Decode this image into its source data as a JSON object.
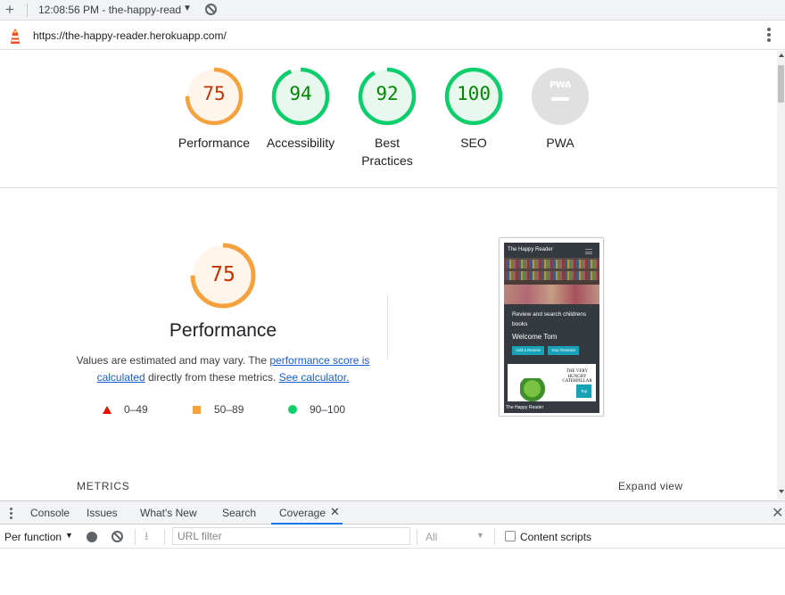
{
  "topbar": {
    "timestamp": "12:08:56 PM - the-happy-read",
    "caret": "▼"
  },
  "urlbar": {
    "url": "https://the-happy-reader.herokuapp.com/"
  },
  "gauges": [
    {
      "score": "75",
      "label": "Performance",
      "fraction": 0.75,
      "color": "#f4a13e",
      "fill": "#fff5ea",
      "text_color": "#c33300"
    },
    {
      "score": "94",
      "label": "Accessibility",
      "fraction": 0.94,
      "color": "#0cce6b",
      "fill": "#e9f8ef",
      "text_color": "#008800"
    },
    {
      "score": "92",
      "label": "Best Practices",
      "fraction": 0.92,
      "color": "#0cce6b",
      "fill": "#e9f8ef",
      "text_color": "#008800"
    },
    {
      "score": "100",
      "label": "SEO",
      "fraction": 1.0,
      "color": "#0cce6b",
      "fill": "#e9f8ef",
      "text_color": "#008800"
    },
    {
      "label": "PWA",
      "icon": "pwa-icon",
      "color": "#e0e0e0"
    }
  ],
  "performance": {
    "score": "75",
    "fraction": 0.75,
    "title": "Performance",
    "desc_before": "Values are estimated and may vary. The ",
    "link1": "performance score is calculated",
    "desc_mid": " directly from these metrics. ",
    "link2": "See calculator."
  },
  "legend": [
    {
      "range": "0–49",
      "icon": "triangle-icon",
      "color": "#eb0f00"
    },
    {
      "range": "50–89",
      "icon": "square-icon",
      "color": "#f4a13e"
    },
    {
      "range": "90–100",
      "icon": "circle-icon",
      "color": "#0cce6b"
    }
  ],
  "screenshot": {
    "brand": "The Happy Reader",
    "headline": "Review and search childrens books",
    "welcome": "Welcome Tom",
    "btn_add": "Add a Review",
    "btn_yours": "Your Reviews",
    "book_title": "THE VERY HUNGRY CATERPILLAR",
    "tag": "Top",
    "footer": "The Happy Reader"
  },
  "metrics": {
    "heading": "METRICS",
    "expand": "Expand view"
  },
  "devtools": {
    "tabs": [
      "Console",
      "Issues",
      "What's New",
      "Search",
      "Coverage"
    ],
    "active_tab": "Coverage",
    "toolbar": {
      "mode": "Per function",
      "filter_placeholder": "URL filter",
      "type": "All",
      "content_scripts": "Content scripts"
    }
  }
}
